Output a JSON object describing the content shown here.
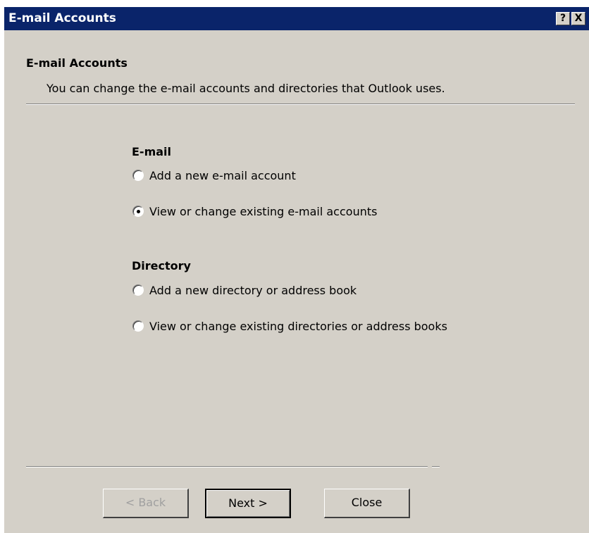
{
  "window": {
    "title": "E-mail Accounts",
    "help_glyph": "?",
    "close_glyph": "X"
  },
  "header": {
    "title": "E-mail Accounts",
    "description": "You can change the e-mail accounts and directories that Outlook uses."
  },
  "email_section": {
    "title": "E-mail",
    "options": [
      {
        "label": "Add a new e-mail account",
        "checked": false
      },
      {
        "label": "View or change existing e-mail accounts",
        "checked": true
      }
    ]
  },
  "directory_section": {
    "title": "Directory",
    "options": [
      {
        "label": "Add a new directory or address book",
        "checked": false
      },
      {
        "label": "View or change existing directories or address books",
        "checked": false
      }
    ]
  },
  "buttons": {
    "back": "< Back",
    "next": "Next >",
    "close": "Close"
  },
  "colors": {
    "titlebar": "#0a246a",
    "dialog_bg": "#d4d0c8"
  },
  "icons": [
    "help-icon",
    "close-icon",
    "radio-unchecked-icon",
    "radio-checked-icon"
  ]
}
